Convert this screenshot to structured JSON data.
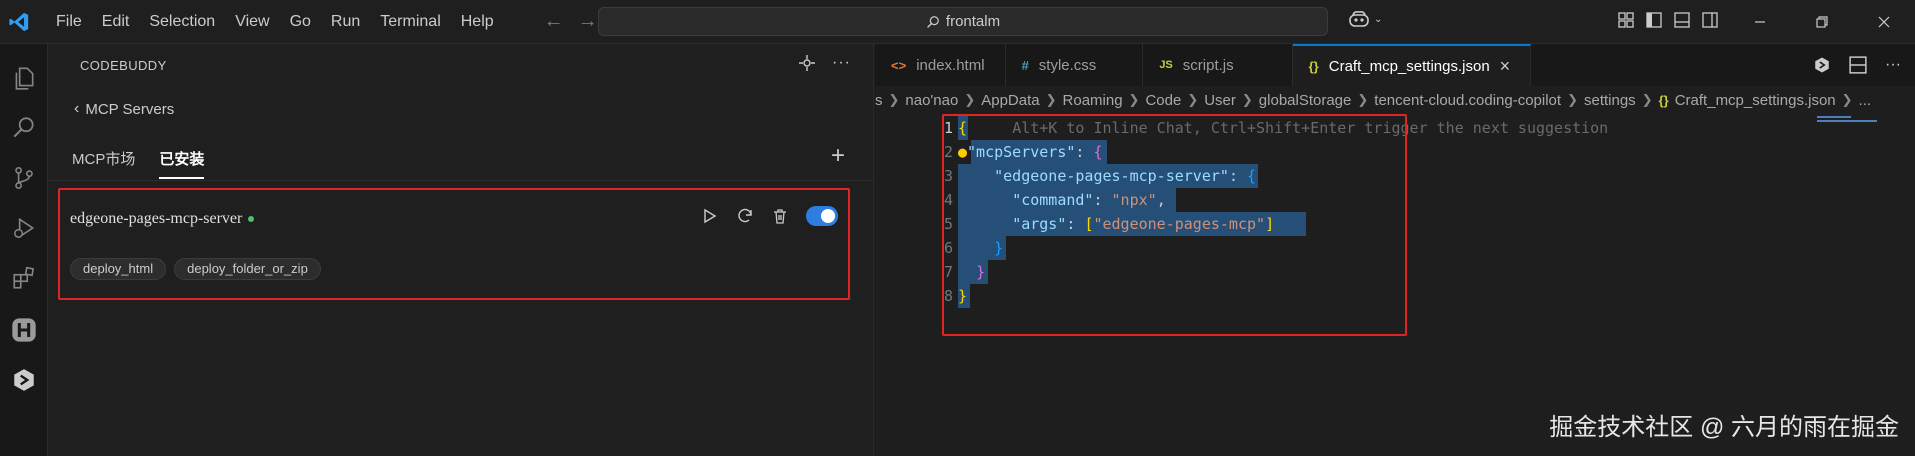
{
  "menu": [
    "File",
    "Edit",
    "Selection",
    "View",
    "Go",
    "Run",
    "Terminal",
    "Help"
  ],
  "search": {
    "text": "frontalm"
  },
  "panel": {
    "title": "CODEBUDDY",
    "back_label": "MCP Servers",
    "tabs": [
      "MCP市场",
      "已安装"
    ],
    "active_tab": "已安装",
    "add_label": "+"
  },
  "server": {
    "name": "edgeone-pages-mcp-server",
    "status_color": "#4fc16b",
    "enabled": true,
    "tools": [
      "deploy_html",
      "deploy_folder_or_zip"
    ]
  },
  "editor": {
    "tabs": [
      {
        "icon": "<>",
        "label": "index.html",
        "color": "#e37933"
      },
      {
        "icon": "#",
        "label": "style.css",
        "color": "#519aba"
      },
      {
        "icon": "JS",
        "label": "script.js",
        "color": "#cbcb41"
      },
      {
        "icon": "{}",
        "label": "Craft_mcp_settings.json",
        "color": "#cbcb41"
      }
    ],
    "active_tab": "Craft_mcp_settings.json",
    "close_label": "×",
    "breadcrumb": [
      "s",
      "nao'nao",
      "AppData",
      "Roaming",
      "Code",
      "User",
      "globalStorage",
      "tencent-cloud.coding-copilot",
      "settings",
      "Craft_mcp_settings.json",
      "..."
    ],
    "ghost_hint": "Alt+K to Inline Chat, Ctrl+Shift+Enter trigger the next suggestion",
    "line_numbers": [
      "1",
      "2",
      "3",
      "4",
      "5",
      "6",
      "7",
      "8"
    ],
    "code": {
      "mcpServers": "\"mcpServers\"",
      "server_key": "\"edgeone-pages-mcp-server\"",
      "command_key": "\"command\"",
      "command_val": "\"npx\"",
      "args_key": "\"args\"",
      "args_val": "\"edgeone-pages-mcp\""
    }
  },
  "watermark": "掘金技术社区 @ 六月的雨在掘金",
  "colors": {
    "accent": "#0078d4",
    "highlight_box": "#e02424",
    "toggle_on": "#2f7de1"
  }
}
